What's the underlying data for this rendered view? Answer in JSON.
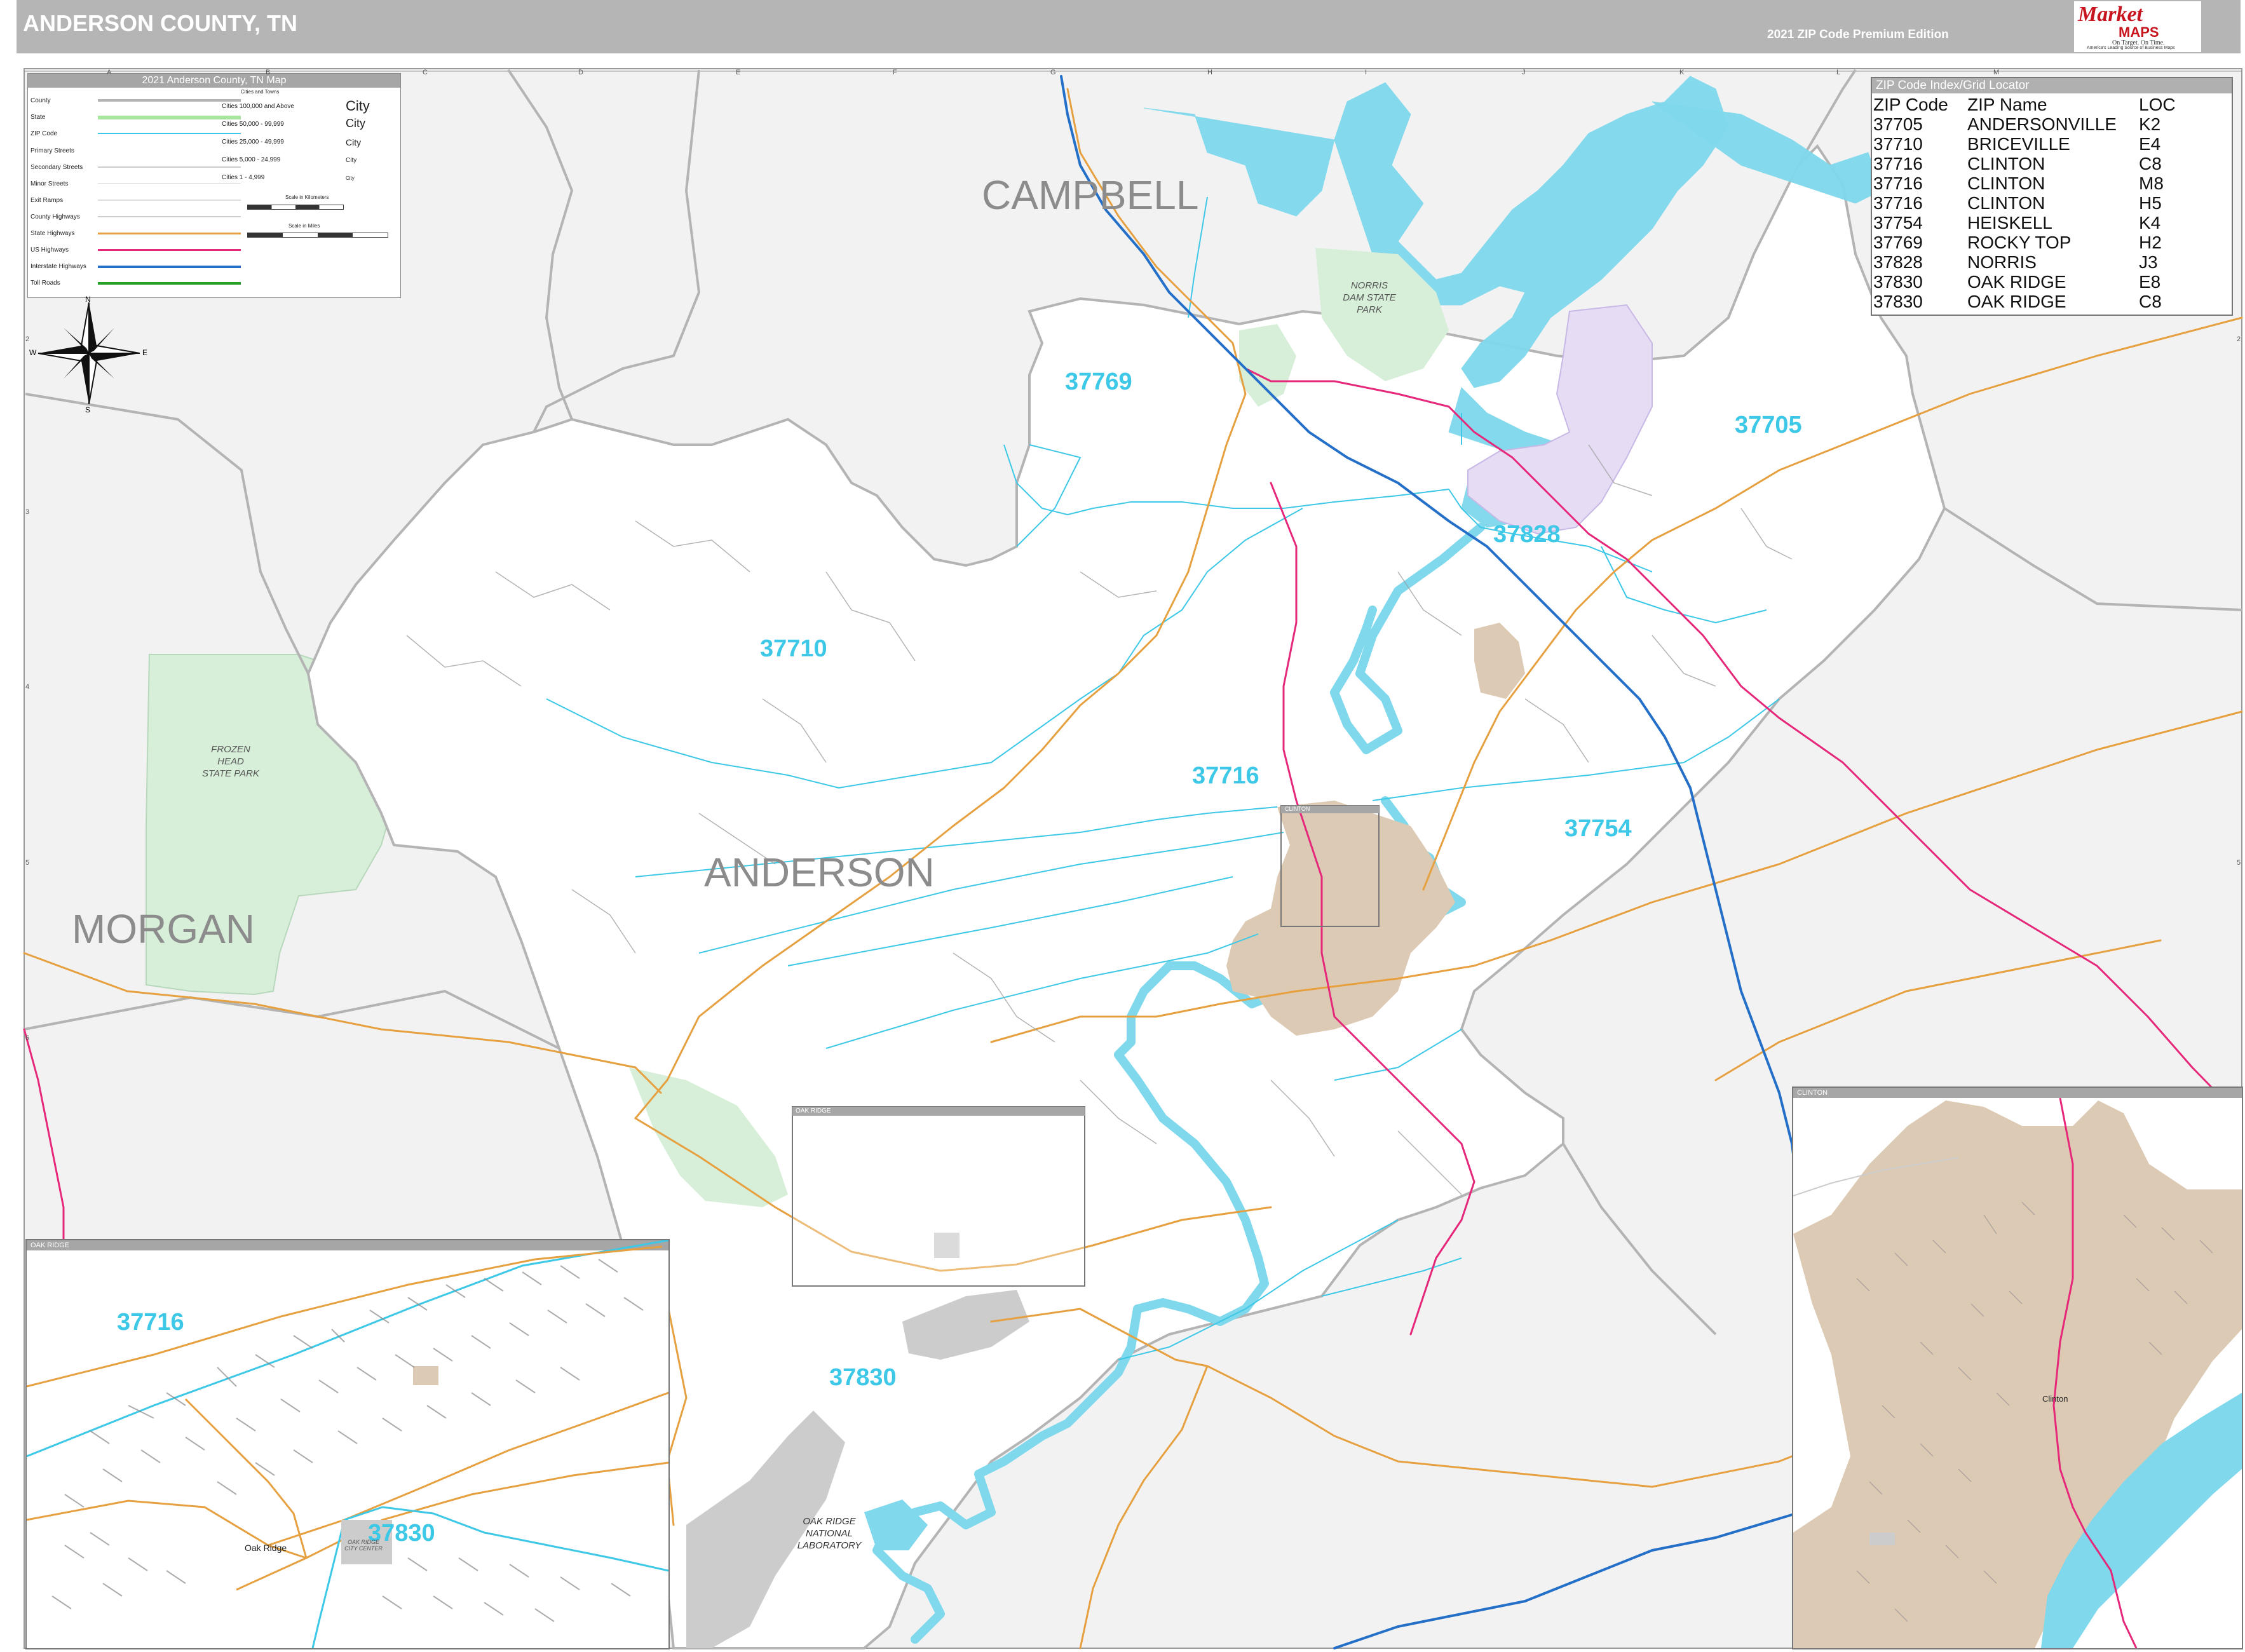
{
  "header": {
    "title": "ANDERSON COUNTY, TN",
    "edition": "2021 ZIP Code Premium Edition"
  },
  "logo": {
    "brand_a": "Market",
    "brand_b": "MAPS",
    "tagline": "On Target.  On Time.",
    "sub": "America's Leading Source of Business Maps"
  },
  "legend": {
    "title": "2021 Anderson County, TN Map",
    "rows": [
      "County",
      "State",
      "ZIP Code",
      "Primary Streets",
      "Secondary Streets",
      "Minor Streets",
      "Exit Ramps",
      "County Highways",
      "State Highways",
      "US Highways",
      "Interstate Highways",
      "Toll Roads"
    ],
    "cities_title": "Cities and Towns",
    "cities": [
      {
        "label": "Cities 100,000 and Above",
        "sample": "City"
      },
      {
        "label": "Cities 50,000 - 99,999",
        "sample": "City"
      },
      {
        "label": "Cities 25,000 - 49,999",
        "sample": "City"
      },
      {
        "label": "Cities 5,000 - 24,999",
        "sample": "City"
      },
      {
        "label": "Cities 1 - 4,999",
        "sample": "City"
      }
    ],
    "scale_km": "Scale in Kilometers",
    "scale_mi": "Scale in Miles",
    "colors": {
      "county": "#b4b4b4",
      "state": "#a8e6a0",
      "zip": "#3cc8e6",
      "state_hwy": "#e6a040",
      "us_hwy": "#e6287a",
      "interstate": "#2470c8",
      "toll": "#28a028"
    }
  },
  "compass": {
    "n": "N",
    "s": "S",
    "e": "E",
    "w": "W"
  },
  "zip_index": {
    "title": "ZIP Code Index/Grid Locator",
    "headers": [
      "ZIP Code",
      "ZIP Name",
      "LOC"
    ],
    "rows": [
      [
        "37705",
        "ANDERSONVILLE",
        "K2"
      ],
      [
        "37710",
        "BRICEVILLE",
        "E4"
      ],
      [
        "37716",
        "CLINTON",
        "C8"
      ],
      [
        "37716",
        "CLINTON",
        "M8"
      ],
      [
        "37716",
        "CLINTON",
        "H5"
      ],
      [
        "37754",
        "HEISKELL",
        "K4"
      ],
      [
        "37769",
        "ROCKY TOP",
        "H2"
      ],
      [
        "37828",
        "NORRIS",
        "J3"
      ],
      [
        "37830",
        "OAK RIDGE",
        "E8"
      ],
      [
        "37830",
        "OAK RIDGE",
        "C8"
      ]
    ]
  },
  "counties": [
    "CAMPBELL",
    "ANDERSON",
    "MORGAN"
  ],
  "zips": [
    "37769",
    "37705",
    "37710",
    "37828",
    "37716",
    "37754",
    "37830"
  ],
  "parks": {
    "norris": "NORRIS DAM STATE PARK",
    "frozen": "FROZEN HEAD STATE PARK",
    "ornl": "OAK RIDGE NATIONAL LABORATORY"
  },
  "grid_cols": [
    "A",
    "B",
    "C",
    "D",
    "E",
    "F",
    "G",
    "H",
    "I",
    "J",
    "K",
    "L",
    "M"
  ],
  "grid_rows": [
    "2",
    "3",
    "4",
    "5",
    "6",
    "7",
    "8",
    "9"
  ],
  "insets": {
    "oak_ridge": {
      "title": "OAK RIDGE",
      "zip_a": "37716",
      "zip_b": "37830",
      "city": "Oak Ridge",
      "center": "OAK RIDGE CITY CENTER"
    },
    "clinton": {
      "title": "CLINTON",
      "place": "Clinton"
    },
    "small_oak_ridge": {
      "title": "OAK RIDGE"
    },
    "small_clinton": {
      "title": "CLINTON"
    }
  },
  "colors": {
    "background": "#f2f2f2",
    "county_fill": "#ffffff",
    "water": "#7fd8ec",
    "park": "#d7efd9",
    "urban": "#dccab4",
    "interstate": "#2470c8",
    "us_hwy": "#e6287a",
    "state_hwy": "#e6a040",
    "zip_line": "#3cc8e6",
    "lab": "#cccccc"
  }
}
